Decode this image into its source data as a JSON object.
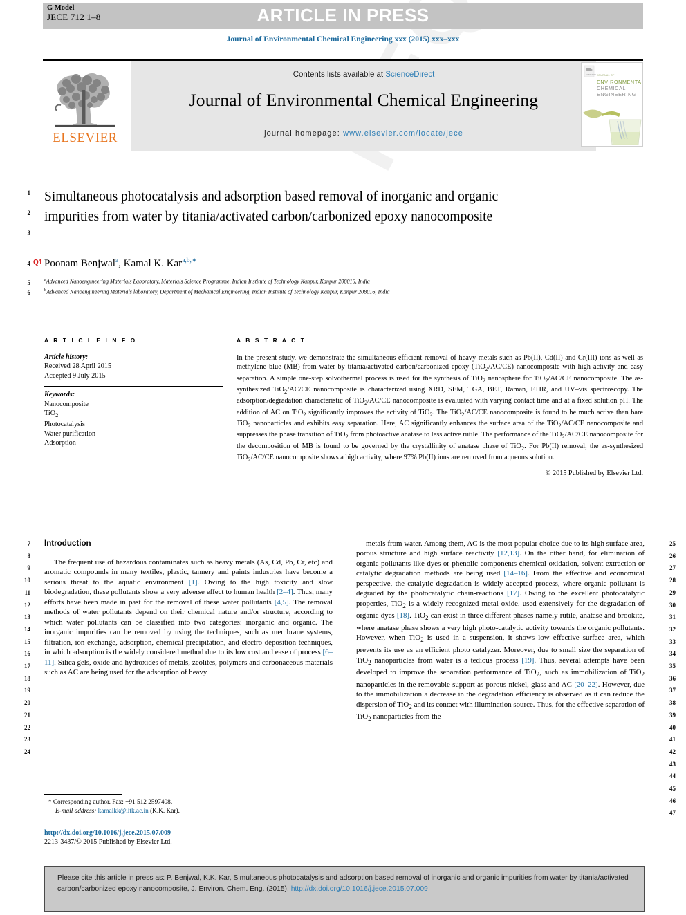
{
  "header": {
    "g_model_label": "G Model",
    "article_id": "JECE 712 1–8",
    "article_in_press": "ARTICLE IN PRESS",
    "journal_ref_line": "Journal of Environmental Chemical Engineering xxx (2015) xxx–xxx",
    "watermark_text": "REQ PROOF"
  },
  "masthead": {
    "contents_prefix": "Contents lists available at ",
    "sciencedirect_link": "ScienceDirect",
    "journal_title": "Journal of Environmental Chemical Engineering",
    "homepage_prefix": "journal homepage: ",
    "homepage_link": "www.elsevier.com/locate/jece",
    "publisher_name": "ELSEVIER",
    "publisher_color": "#e87722",
    "link_color": "#2e7eb5",
    "cover_line1": "JOURNAL OF",
    "cover_line2": "ENVIRONMENTAL",
    "cover_line3": "CHEMICAL",
    "cover_line4": "ENGINEERING"
  },
  "article": {
    "title": "Simultaneous photocatalysis and adsorption based removal of inorganic and organic impurities from water by titania/activated carbon/carbonized epoxy nanocomposite",
    "authors_html": "Poonam Benjwal<sup>a</sup>, Kamal K. Kar<sup>a,b,∗</sup>",
    "query_badge": "Q1",
    "affiliations": [
      {
        "marker": "a",
        "text": "Advanced Nanoengineering Materials Laboratory, Materials Science Programme, Indian Institute of Technology Kanpur, Kanpur 208016, India"
      },
      {
        "marker": "b",
        "text": "Advanced Nanoengineering Materials laboratory, Department of Mechanical Engineering, Indian Institute of Technology Kanpur, Kanpur 208016, India"
      }
    ]
  },
  "article_info": {
    "heading": "A R T I C L E  I N F O",
    "history_label": "Article history:",
    "received": "Received 28 April 2015",
    "accepted": "Accepted 9 July 2015",
    "keywords_label": "Keywords:",
    "keywords": [
      "Nanocomposite",
      "TiO2",
      "Photocatalysis",
      "Water purification",
      "Adsorption"
    ]
  },
  "abstract": {
    "heading": "A B S T R A C T",
    "text": "In the present study, we demonstrate the simultaneous efficient removal of heavy metals such as Pb(II), Cd(II) and Cr(III) ions as well as methylene blue (MB) from water by titania/activated carbon/carbonized epoxy (TiO2/AC/CE) nanocomposite with high activity and easy separation. A simple one-step solvothermal process is used for the synthesis of TiO2 nanosphere for TiO2/AC/CE nanocomposite. The as-synthesized TiO2/AC/CE nanocomposite is characterized using XRD, SEM, TGA, BET, Raman, FTIR, and UV–vis spectroscopy. The adsorption/degradation characteristic of TiO2/AC/CE nanocomposite is evaluated with varying contact time and at a fixed solution pH. The addition of AC on TiO2 significantly improves the activity of TiO2. The TiO2/AC/CE nanocomposite is found to be much active than bare TiO2 nanoparticles and exhibits easy separation. Here, AC significantly enhances the surface area of the TiO2/AC/CE nanocomposite and suppresses the phase transition of TiO2 from photoactive anatase to less active rutile. The performance of the TiO2/AC/CE nanocomposite for the decomposition of MB is found to be governed by the crystallinity of anatase phase of TiO2. For Pb(II) removal, the as-synthesized TiO2/AC/CE nanocomposite shows a high activity, where 97% Pb(II) ions are removed from aqueous solution.",
    "copyright": "© 2015 Published by Elsevier Ltd."
  },
  "body": {
    "section_heading": "Introduction",
    "left_column_paragraph": "The frequent use of hazardous contaminates such as heavy metals (As, Cd, Pb, Cr, etc) and aromatic compounds in many textiles, plastic, tannery and paints industries have become a serious threat to the aquatic environment [1]. Owing to the high toxicity and slow biodegradation, these pollutants show a very adverse effect to human health [2–4]. Thus, many efforts have been made in past for the removal of these water pollutants [4,5]. The removal methods of water pollutants depend on their chemical nature and/or structure, according to which water pollutants can be classified into two categories: inorganic and organic. The inorganic impurities can be removed by using the techniques, such as membrane systems, filtration, ion-exchange, adsorption, chemical precipitation, and electro-deposition techniques, in which adsorption is the widely considered method due to its low cost and ease of process [6–11]. Silica gels, oxide and hydroxides of metals, zeolites, polymers and carbonaceous materials such as AC are being used for the adsorption of heavy",
    "right_column_paragraph": "metals from water. Among them, AC is the most popular choice due to its high surface area, porous structure and high surface reactivity [12,13]. On the other hand, for elimination of organic pollutants like dyes or phenolic components chemical oxidation, solvent extraction or catalytic degradation methods are being used [14–16]. From the effective and economical perspective, the catalytic degradation is widely accepted process, where organic pollutant is degraded by the photocatalytic chain-reactions [17]. Owing to the excellent photocatalytic properties, TiO2 is a widely recognized metal oxide, used extensively for the degradation of organic dyes [18]. TiO2 can exist in three different phases namely rutile, anatase and brookite, where anatase phase shows a very high photo-catalytic activity towards the organic pollutants. However, when TiO2 is used in a suspension, it shows low effective surface area, which prevents its use as an efficient photo catalyzer. Moreover, due to small size the separation of TiO2 nanoparticles from water is a tedious process [19]. Thus, several attempts have been developed to improve the separation performance of TiO2, such as immobilization of TiO2 nanoparticles in the removable support as porous nickel, glass and AC [20–22]. However, due to the immobilization a decrease in the degradation efficiency is observed as it can reduce the dispersion of TiO2 and its contact with illumination source. Thus, for the effective separation of TiO2 nanoparticles from the",
    "left_line_numbers": [
      7,
      8,
      9,
      10,
      11,
      12,
      13,
      14,
      15,
      16,
      17,
      18,
      19,
      20,
      21,
      22,
      23,
      24
    ],
    "right_line_numbers": [
      25,
      26,
      27,
      28,
      29,
      30,
      31,
      32,
      33,
      34,
      35,
      36,
      37,
      38,
      39,
      40,
      41,
      42,
      43,
      44,
      45,
      46,
      47
    ],
    "title_line_numbers": [
      1,
      2,
      3,
      4,
      5,
      6
    ]
  },
  "footnote": {
    "marker": "*",
    "corresponding": "Corresponding author. Fax: +91 512 2597408.",
    "email_label": "E-mail address:",
    "email": "kamalkk@iitk.ac.in",
    "email_suffix": "(K.K. Kar).",
    "doi_url": "http://dx.doi.org/10.1016/j.jece.2015.07.009",
    "issn_line": "2213-3437/© 2015 Published by Elsevier Ltd."
  },
  "cite_box": {
    "text_before_link": "Please cite this article in press as: P. Benjwal, K.K. Kar, Simultaneous photocatalysis and adsorption based removal of inorganic and organic impurities from water by titania/activated carbon/carbonized epoxy nanocomposite, J. Environ. Chem. Eng. (2015), ",
    "link_text": "http://dx.doi.org/10.1016/j.jece.2015.07.009"
  }
}
